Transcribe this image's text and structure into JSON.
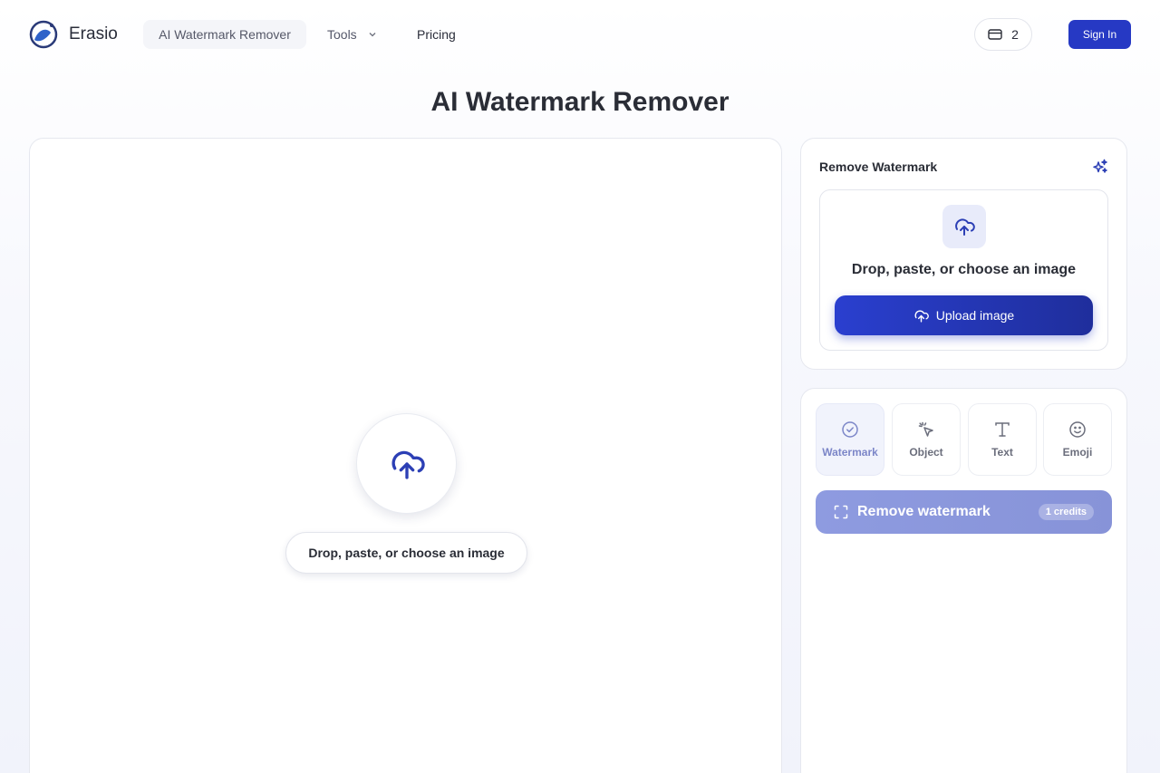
{
  "header": {
    "brand": "Erasio",
    "nav": {
      "active": "AI Watermark Remover",
      "tools": "Tools",
      "pricing": "Pricing"
    },
    "credits_count": "2",
    "signin_label": "Sign In"
  },
  "page_title": "AI Watermark Remover",
  "canvas": {
    "drop_label": "Drop, paste, or choose an image"
  },
  "remove_card": {
    "title": "Remove Watermark",
    "drop_text": "Drop, paste, or choose an image",
    "upload_label": "Upload image"
  },
  "tools_card": {
    "tabs": [
      {
        "label": "Watermark",
        "icon": "check-circle-icon",
        "active": true
      },
      {
        "label": "Object",
        "icon": "cursor-click-icon",
        "active": false
      },
      {
        "label": "Text",
        "icon": "text-type-icon",
        "active": false
      },
      {
        "label": "Emoji",
        "icon": "smile-icon",
        "active": false
      }
    ],
    "action_label": "Remove watermark",
    "action_credits": "1 credits"
  },
  "colors": {
    "accent": "#2639c4",
    "accent_soft": "#8e9be0",
    "text": "#2a2d36"
  }
}
